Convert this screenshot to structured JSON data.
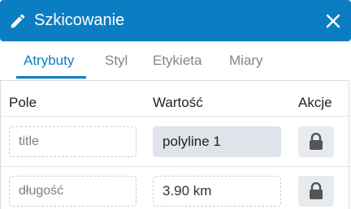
{
  "header": {
    "title": "Szkicowanie",
    "pencil_icon": "pencil-icon",
    "close_icon": "close-icon",
    "background": "#0b7ec3"
  },
  "tabs": [
    {
      "label": "Atrybuty",
      "active": true
    },
    {
      "label": "Styl",
      "active": false
    },
    {
      "label": "Etykieta",
      "active": false
    },
    {
      "label": "Miary",
      "active": false
    }
  ],
  "table": {
    "headers": {
      "field": "Pole",
      "value": "Wartość",
      "actions": "Akcje"
    },
    "rows": [
      {
        "field": "title",
        "value": "polyline 1",
        "action_icon": "lock-icon"
      },
      {
        "field": "długość",
        "value": "3.90 km",
        "action_icon": "lock-icon"
      }
    ]
  }
}
